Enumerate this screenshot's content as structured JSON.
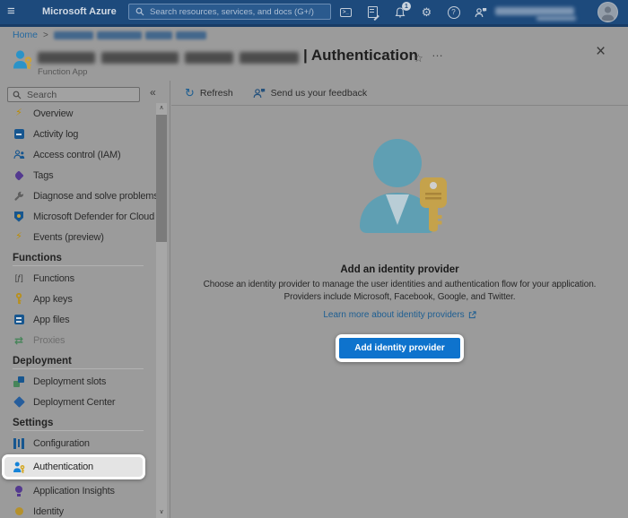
{
  "topbar": {
    "brand": "Microsoft Azure",
    "search_placeholder": "Search resources, services, and docs (G+/)",
    "notification_badge": "1"
  },
  "breadcrumb": {
    "home": "Home",
    "separator": ">"
  },
  "page": {
    "title_suffix": "| Authentication",
    "subtitle": "Function App"
  },
  "toolbar": {
    "refresh_label": "Refresh",
    "feedback_label": "Send us your feedback"
  },
  "sidebar": {
    "search_placeholder": "Search",
    "groups": [
      {
        "items": [
          {
            "label": "Overview"
          },
          {
            "label": "Activity log"
          },
          {
            "label": "Access control (IAM)"
          },
          {
            "label": "Tags"
          },
          {
            "label": "Diagnose and solve problems"
          },
          {
            "label": "Microsoft Defender for Cloud"
          },
          {
            "label": "Events (preview)"
          }
        ]
      },
      {
        "header": "Functions",
        "items": [
          {
            "label": "Functions"
          },
          {
            "label": "App keys"
          },
          {
            "label": "App files"
          },
          {
            "label": "Proxies",
            "disabled": true
          }
        ]
      },
      {
        "header": "Deployment",
        "items": [
          {
            "label": "Deployment slots"
          },
          {
            "label": "Deployment Center"
          }
        ]
      },
      {
        "header": "Settings",
        "items": [
          {
            "label": "Configuration"
          },
          {
            "label": "Authentication",
            "selected": true,
            "highlighted": true
          },
          {
            "label": "Application Insights"
          },
          {
            "label": "Identity"
          }
        ]
      }
    ]
  },
  "main": {
    "heading": "Add an identity provider",
    "description_line1": "Choose an identity provider to manage the user identities and authentication flow for your application.",
    "description_line2": "Providers include Microsoft, Facebook, Google, and Twitter.",
    "learn_more_label": "Learn more about identity providers",
    "add_button_label": "Add identity provider"
  },
  "glyphs": {
    "hamburger": "≡",
    "console": ">_",
    "gear": "⚙",
    "help": "?",
    "collapse": "«",
    "star": "☆",
    "more": "…",
    "close": "×",
    "refresh": "↻",
    "bolt": "⚡",
    "fx": "[ƒ]",
    "proxy": "⇄",
    "scroll_up": "∧",
    "scroll_down": "∨"
  },
  "colors": {
    "topbar_bg": "#1d4a7c",
    "dimmed_page_bg": "#9b9b9b",
    "primary_button_blue": "#0e73cd",
    "link_blue": "#1d5e92",
    "callout_white": "#ffffff",
    "illustration_teal": "#5f9fb3",
    "key_gold": "#c5a24b"
  }
}
